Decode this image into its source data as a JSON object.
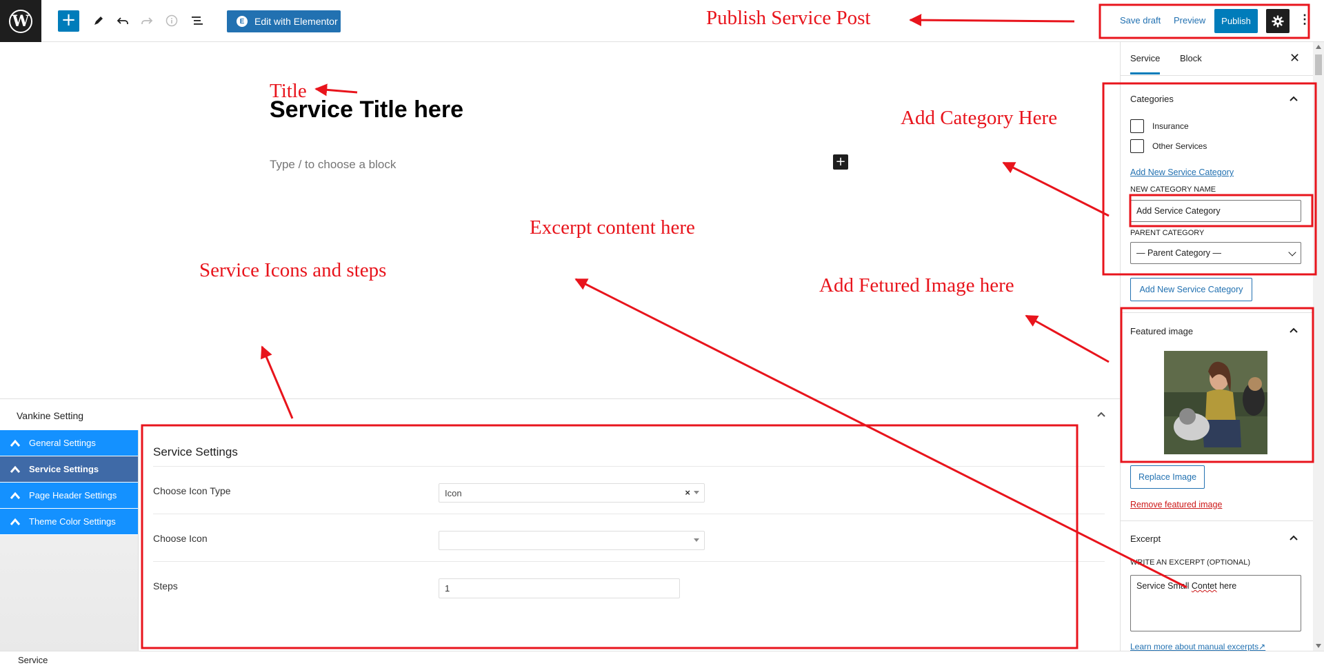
{
  "toolbar": {
    "edit_with_elementor": "Edit with Elementor",
    "elementor_badge": "E",
    "save_draft": "Save draft",
    "preview": "Preview",
    "publish": "Publish",
    "wp_logo_letter": "W"
  },
  "editor": {
    "title": "Service Title here",
    "block_placeholder": "Type / to choose a block"
  },
  "meta_box": {
    "title": "Vankine Setting",
    "nav": [
      {
        "label": "General Settings"
      },
      {
        "label": "Service Settings"
      },
      {
        "label": "Page Header Settings"
      },
      {
        "label": "Theme Color Settings"
      }
    ],
    "active_nav_index": 1,
    "panel": {
      "heading": "Service Settings",
      "fields": [
        {
          "label": "Choose Icon Type",
          "value": "Icon",
          "clear_glyph": "×"
        },
        {
          "label": "Choose Icon",
          "value": ""
        },
        {
          "label": "Steps",
          "value": "1"
        }
      ]
    }
  },
  "status_bar": {
    "breadcrumb": "Service"
  },
  "sidebar": {
    "tabs": [
      "Service",
      "Block"
    ],
    "active_tab": "Service",
    "close_glyph": "✕",
    "categories": {
      "title": "Categories",
      "items": [
        {
          "label": "Insurance",
          "checked": false
        },
        {
          "label": "Other Services",
          "checked": false
        }
      ],
      "add_new_link": "Add New Service Category",
      "new_name_label": "New Category Name",
      "new_name_value": "Add Service Category",
      "parent_label": "Parent Category",
      "parent_value": "— Parent Category —",
      "add_button": "Add New Service Category"
    },
    "featured_image": {
      "title": "Featured image",
      "replace_button": "Replace Image",
      "remove_link": "Remove featured image"
    },
    "excerpt": {
      "title": "Excerpt",
      "label": "Write an excerpt (optional)",
      "value_before": "Service Small ",
      "value_misspelled": "Contet",
      "value_after": " here",
      "learn_more": "Learn more about manual excerpts",
      "external_glyph": "↗"
    }
  },
  "annotations": {
    "publish": "Publish Service Post",
    "title": "Title",
    "category": "Add Category Here",
    "excerpt": "Excerpt content here",
    "icons": "Service Icons and steps",
    "featured": "Add Fetured Image here"
  },
  "colors": {
    "accent": "#007cba",
    "annotation_red": "#e8141c",
    "meta_nav_blue": "#1491ff",
    "meta_nav_active": "#3f6aa7"
  }
}
